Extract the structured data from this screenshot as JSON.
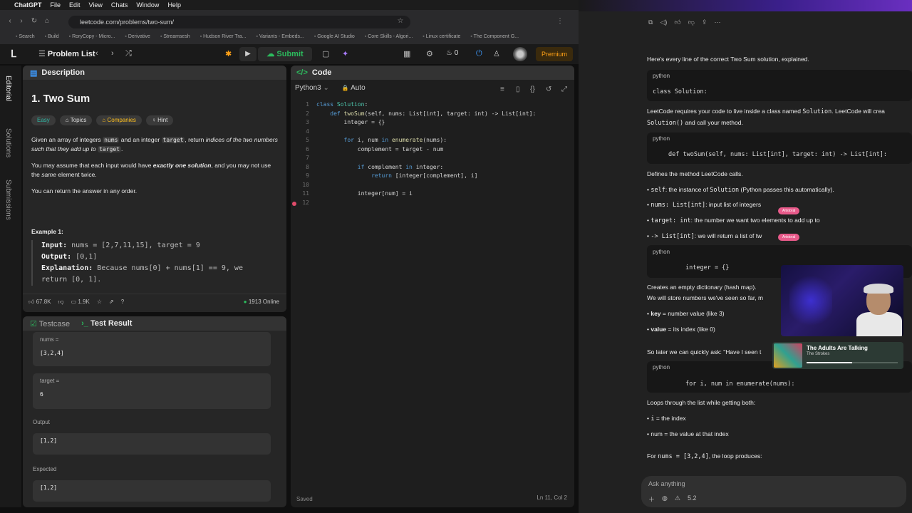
{
  "macbar": {
    "app": "ChatGPT",
    "menus": [
      "File",
      "Edit",
      "View",
      "Chats",
      "Window",
      "Help"
    ]
  },
  "browser": {
    "url": "leetcode.com/problems/two-sum/",
    "bookmarks": [
      "Search",
      "Build",
      "RoryCopy - Micro...",
      "Derivative",
      "Streamsesh",
      "Hudson River Tra...",
      "Variants - Embeds...",
      "Google AI Studio",
      "Core Skills - Algori...",
      "Linux certificate",
      "The Component G..."
    ]
  },
  "leetcode_top": {
    "problem_list": "Problem List",
    "submit": "Submit",
    "streak": "0",
    "premium": "Premium"
  },
  "side_tabs": [
    "Editorial",
    "Solutions",
    "Submissions"
  ],
  "description": {
    "tab": "Description",
    "title": "1. Two Sum",
    "tags": [
      "Easy",
      "Topics",
      "Companies",
      "Hint"
    ],
    "p1_a": "Given an array of integers ",
    "p1_nums": "nums",
    "p1_b": " and an integer ",
    "p1_target": "target",
    "p1_c": ", return ",
    "p1_d": "indices of the two numbers such that they add up to ",
    "p1_target2": "target",
    "p1_e": ".",
    "p2_a": "You may assume that each input would have ",
    "p2_b": "exactly one solution",
    "p2_c": ", and you may not use the ",
    "p2_d": "same",
    "p2_e": " element twice.",
    "p3": "You can return the answer in any order.",
    "example_label": "Example 1:",
    "ex_input_label": "Input:",
    "ex_input": " nums = [2,7,11,15], target = 9",
    "ex_output_label": "Output:",
    "ex_output": " [0,1]",
    "ex_expl_label": "Explanation:",
    "ex_expl": " Because nums[0] + nums[1] == 9, we",
    "ex_expl2": "return [0, 1]."
  },
  "stats": {
    "likes": "67.8K",
    "comments": "1.9K",
    "online": "1913 Online"
  },
  "testpanel": {
    "tab1": "Testcase",
    "tab2": "Test Result",
    "nums_label": "nums =",
    "nums_value": "[3,2,4]",
    "target_label": "target =",
    "target_value": "6",
    "output_label": "Output",
    "output_value": "[1,2]",
    "expected_label": "Expected",
    "expected_value": "[1,2]"
  },
  "code": {
    "tab": "Code",
    "language": "Python3",
    "mode": "Auto",
    "status": "Saved",
    "cursor": "Ln 11, Col 2",
    "lines": [
      {
        "n": "1",
        "text": "class Solution:"
      },
      {
        "n": "2",
        "text": "    def twoSum(self, nums: List[int], target: int) -> List[int]:"
      },
      {
        "n": "3",
        "text": "        integer = {}"
      },
      {
        "n": "4",
        "text": ""
      },
      {
        "n": "5",
        "text": "        for i, num in enumerate(nums):"
      },
      {
        "n": "6",
        "text": "            complement = target - num"
      },
      {
        "n": "7",
        "text": ""
      },
      {
        "n": "8",
        "text": "            if complement in integer:"
      },
      {
        "n": "9",
        "text": "                return [integer[complement], i]"
      },
      {
        "n": "10",
        "text": ""
      },
      {
        "n": "11",
        "text": "            integer[num] = i"
      },
      {
        "n": "12",
        "text": ""
      }
    ]
  },
  "chat": {
    "intro": "Here's every line of the correct Two Sum solution, explained.",
    "lang": "python",
    "code1": "class Solution:",
    "text1a": "LeetCode requires your code to live inside a class named ",
    "text1b": "Solution",
    "text1c": ". LeetCode will crea",
    "text1d": "Solution()",
    "text1e": " and call your method.",
    "code2": "def twoSum(self, nums: List[int], target: int) -> List[int]:",
    "text2": "Defines the method LeetCode calls.",
    "b1a": "• ",
    "b1b": "self",
    "b1c": ": the instance of ",
    "b1d": "Solution",
    "b1e": " (Python passes this automatically).",
    "b2a": "• ",
    "b2b": "nums: List[int]",
    "b2c": ": input list of integers",
    "b3a": "• ",
    "b3b": "target: int",
    "b3c": ": the number we want two elements to add up to",
    "b4a": "• ",
    "b4b": "-> List[int]",
    "b4c": ": we will return a list of tw",
    "code3": "integer = {}",
    "text3a": "Creates an empty dictionary (hash map).",
    "text3b": "We will store numbers we've seen so far, m",
    "b5a": "• ",
    "b5b": "key",
    "b5c": " = number value (like 3)",
    "b6a": "• ",
    "b6b": "value",
    "b6c": " = its index (like 0)",
    "text4": "So later we can quickly ask: \"Have I seen t",
    "code4": "for i, num in enumerate(nums):",
    "text5": "Loops through the list while getting both:",
    "b7a": "• ",
    "b7b": "i",
    "b7c": " = the index",
    "b8a": "• ",
    "b8b": "num",
    "b8c": " = the value at that index",
    "text6a": "For ",
    "text6b": "nums = [3,2,4]",
    "text6c": ", the loop produces:",
    "ask_placeholder": "Ask anything",
    "ask_model": "5.2"
  },
  "overlay": {
    "pill1": "Aristoral",
    "pill2": "Aristoral",
    "now_playing_title": "The Adults Are Talking",
    "now_playing_artist": "The Strokes"
  }
}
